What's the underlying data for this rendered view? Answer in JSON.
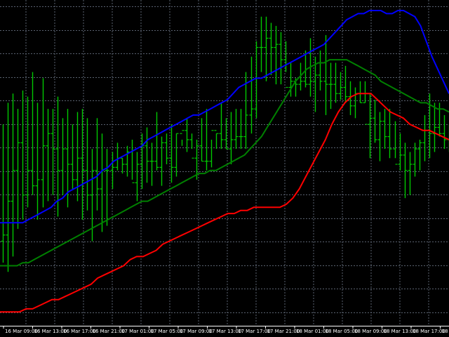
{
  "colors": {
    "background": "#000000",
    "grid": "#5a6270",
    "bars": "#00c800",
    "upper_band": "#0000ff",
    "middle_band": "#008000",
    "lower_band": "#ff0000",
    "tick_text": "#ffffff"
  },
  "chart_data": {
    "type": "line",
    "title": "",
    "xlabel": "",
    "ylabel": "",
    "grid": true,
    "legend": "none",
    "x_tick_labels": [
      "16 Mar 09:00",
      "16 Mar 13:00",
      "16 Mar 17:00",
      "16 Mar 21:00",
      "17 Mar 01:00",
      "17 Mar 05:00",
      "17 Mar 09:00",
      "17 Mar 13:00",
      "17 Mar 17:00",
      "17 Mar 21:00",
      "18 Mar 01:00",
      "18 Mar 05:00",
      "18 Mar 09:00",
      "18 Mar 13:00",
      "18 Mar 17:00",
      "18 M"
    ],
    "ylim": [
      0,
      100
    ],
    "ohlc_bars": {
      "name": "price",
      "high": [
        63,
        70,
        73,
        68,
        74,
        72,
        80,
        70,
        78,
        68,
        68,
        72,
        65,
        68,
        63,
        67,
        68,
        65,
        55,
        65,
        60,
        55,
        54,
        57,
        52,
        56,
        58,
        54,
        60,
        62,
        57,
        67,
        59,
        60,
        63,
        60,
        58,
        65,
        60,
        58,
        65,
        68,
        58,
        60,
        70,
        65,
        67,
        68,
        68,
        80,
        85,
        90,
        98,
        98,
        96,
        95,
        93,
        90,
        83,
        78,
        83,
        87,
        91,
        85,
        87,
        92,
        83,
        83,
        80,
        82,
        77,
        75,
        77,
        77,
        73,
        71,
        67,
        68,
        68,
        64,
        60,
        57,
        54,
        57,
        58,
        66,
        73,
        70,
        70,
        66,
        63
      ],
      "low": [
        18,
        15,
        20,
        29,
        32,
        36,
        40,
        32,
        36,
        38,
        40,
        33,
        40,
        36,
        42,
        38,
        32,
        35,
        25,
        35,
        28,
        30,
        42,
        48,
        47,
        46,
        45,
        38,
        42,
        44,
        43,
        48,
        43,
        50,
        44,
        46,
        56,
        54,
        55,
        45,
        51,
        48,
        49,
        55,
        55,
        55,
        50,
        55,
        55,
        55,
        60,
        65,
        80,
        77,
        79,
        76,
        76,
        80,
        72,
        72,
        74,
        75,
        72,
        67,
        74,
        66,
        68,
        70,
        71,
        70,
        66,
        65,
        70,
        70,
        52,
        57,
        51,
        55,
        52,
        52,
        48,
        39,
        40,
        46,
        48,
        51,
        52,
        54,
        59,
        55,
        54
      ],
      "open": [
        25,
        27,
        38,
        48,
        57,
        40,
        48,
        43,
        45,
        56,
        60,
        55,
        48,
        55,
        50,
        45,
        52,
        48,
        40,
        48,
        42,
        48,
        48,
        49,
        52,
        50,
        54,
        44,
        50,
        56,
        51,
        51,
        49,
        57,
        52,
        49,
        60,
        61,
        58,
        52,
        56,
        51,
        51,
        61,
        60,
        58,
        55,
        58,
        59,
        59,
        66,
        68,
        88,
        88,
        91,
        88,
        89,
        84,
        75,
        77,
        76,
        77,
        76,
        77,
        79,
        77,
        76,
        76,
        73,
        75,
        72,
        69,
        73,
        70,
        63,
        65,
        58,
        64,
        59,
        55,
        50,
        53,
        48,
        50,
        55,
        57,
        61,
        60,
        62,
        60,
        58
      ],
      "close": [
        27,
        38,
        48,
        57,
        40,
        48,
        43,
        45,
        56,
        60,
        55,
        48,
        55,
        50,
        45,
        52,
        48,
        40,
        48,
        42,
        48,
        48,
        49,
        52,
        50,
        54,
        44,
        50,
        56,
        51,
        51,
        49,
        57,
        52,
        49,
        60,
        61,
        58,
        52,
        56,
        51,
        51,
        61,
        60,
        58,
        55,
        58,
        59,
        59,
        66,
        68,
        88,
        88,
        91,
        88,
        89,
        84,
        75,
        77,
        76,
        77,
        76,
        77,
        79,
        77,
        76,
        76,
        73,
        75,
        72,
        69,
        73,
        70,
        63,
        65,
        58,
        64,
        59,
        55,
        50,
        53,
        48,
        50,
        55,
        57,
        61,
        60,
        62,
        60,
        58,
        60
      ]
    },
    "series": [
      {
        "values": [
          31,
          31,
          31,
          31,
          31,
          32,
          33,
          34,
          35,
          36,
          38,
          39,
          41,
          42,
          43,
          44,
          45,
          46,
          48,
          49,
          51,
          52,
          53,
          54,
          55,
          56,
          58,
          59,
          60,
          61,
          62,
          63,
          64,
          65,
          66,
          66,
          67,
          68,
          69,
          70,
          71,
          73,
          75,
          76,
          77,
          78,
          78,
          79,
          80,
          81,
          82,
          83,
          84,
          85,
          86,
          87,
          88,
          89,
          91,
          93,
          95,
          97,
          98,
          99,
          99,
          100,
          100,
          100,
          99,
          99,
          100,
          100,
          99,
          98,
          95,
          90,
          85,
          81,
          77,
          73
        ]
      },
      {
        "values": [
          17,
          17,
          17,
          17,
          18,
          18,
          19,
          20,
          21,
          22,
          23,
          24,
          25,
          26,
          27,
          28,
          29,
          30,
          31,
          32,
          33,
          34,
          35,
          36,
          37,
          38,
          38,
          39,
          40,
          41,
          42,
          43,
          44,
          45,
          46,
          47,
          47,
          48,
          48,
          49,
          50,
          51,
          52,
          53,
          55,
          57,
          59,
          62,
          65,
          68,
          71,
          74,
          77,
          79,
          81,
          82,
          83,
          83,
          84,
          84,
          84,
          84,
          83,
          82,
          81,
          80,
          79,
          77,
          76,
          75,
          74,
          73,
          72,
          71,
          70,
          70,
          69,
          68,
          68,
          67
        ]
      },
      {
        "values": [
          2,
          2,
          2,
          2,
          3,
          3,
          4,
          5,
          6,
          6,
          7,
          8,
          9,
          10,
          11,
          13,
          14,
          15,
          16,
          17,
          19,
          20,
          20,
          21,
          22,
          24,
          25,
          26,
          27,
          28,
          29,
          30,
          31,
          32,
          33,
          34,
          34,
          35,
          35,
          36,
          36,
          36,
          36,
          36,
          37,
          39,
          42,
          46,
          50,
          54,
          58,
          63,
          67,
          70,
          72,
          73,
          73,
          73,
          71,
          69,
          67,
          66,
          65,
          63,
          62,
          61,
          61,
          60,
          59,
          58
        ]
      }
    ]
  }
}
